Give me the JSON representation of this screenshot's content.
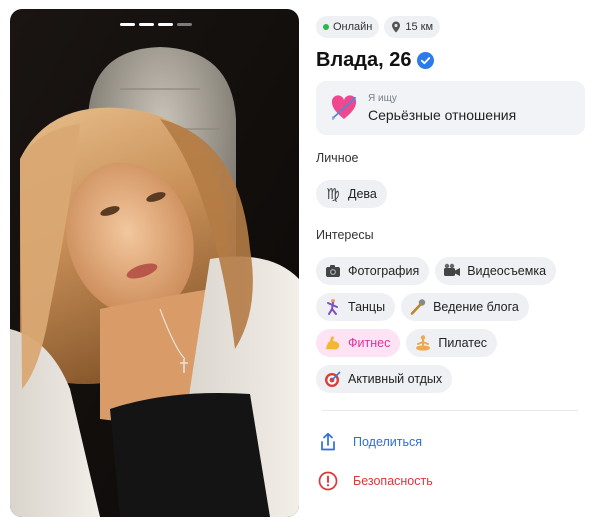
{
  "profile": {
    "status": "Онлайн",
    "distance": "15 км",
    "name_age": "Влада, 26",
    "photo_pages": 4,
    "photo_current": 3
  },
  "looking_for": {
    "label": "Я ищу",
    "value": "Серьёзные отношения"
  },
  "personal": {
    "title": "Личное",
    "zodiac": "Дева",
    "zodiac_icon": "♍"
  },
  "interests": {
    "title": "Интересы",
    "items": [
      {
        "label": "Фотография",
        "icon": "camera-icon"
      },
      {
        "label": "Видеосъемка",
        "icon": "video-camera-icon"
      },
      {
        "label": "Танцы",
        "icon": "dancer-icon"
      },
      {
        "label": "Ведение блога",
        "icon": "microphone-icon"
      },
      {
        "label": "Фитнес",
        "icon": "flexed-biceps-icon",
        "highlight": true
      },
      {
        "label": "Пилатес",
        "icon": "lotus-pose-icon"
      },
      {
        "label": "Активный отдых",
        "icon": "target-icon"
      }
    ]
  },
  "actions": {
    "share": "Поделиться",
    "safety": "Безопасность"
  },
  "colors": {
    "online": "#2ab84b",
    "verified": "#2b7bea",
    "share": "#2d6fd6",
    "safety": "#e0353b",
    "highlight_bg": "#fde3f3",
    "highlight_text": "#e0329c"
  }
}
